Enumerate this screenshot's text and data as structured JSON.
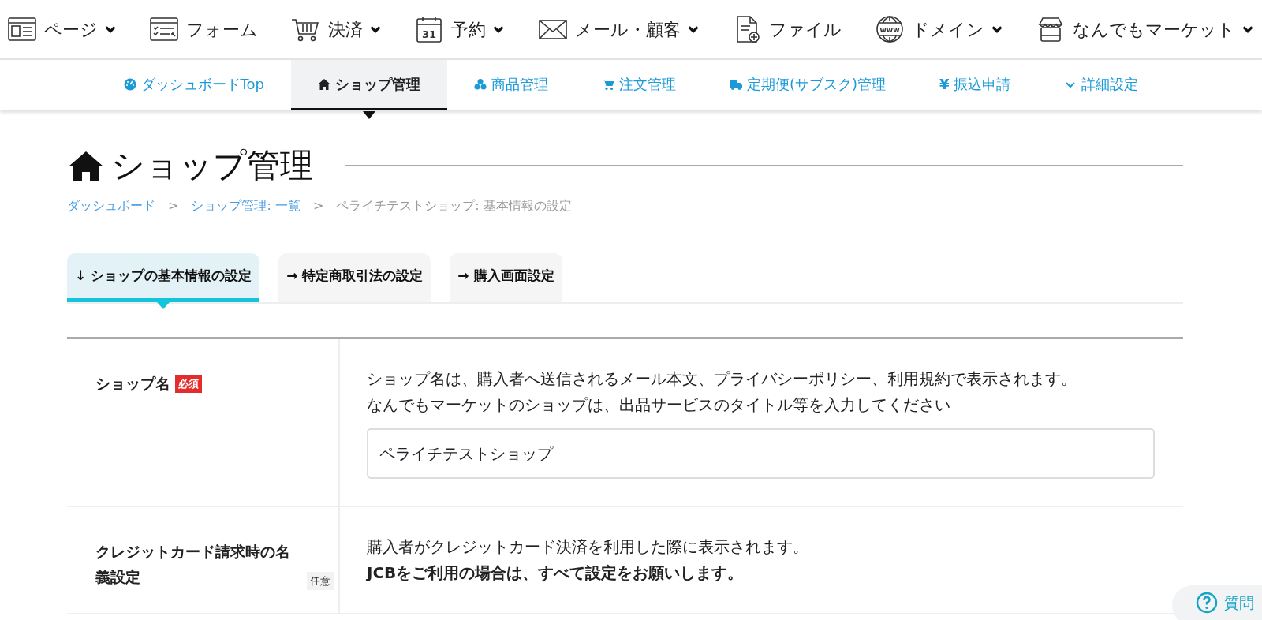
{
  "top_nav": [
    {
      "label": "ページ",
      "has_menu": true
    },
    {
      "label": "フォーム",
      "has_menu": false
    },
    {
      "label": "決済",
      "has_menu": true
    },
    {
      "label": "予約",
      "has_menu": true,
      "icon_text": "31"
    },
    {
      "label": "メール・顧客",
      "has_menu": true
    },
    {
      "label": "ファイル",
      "has_menu": false
    },
    {
      "label": "ドメイン",
      "has_menu": true,
      "icon_text": "www"
    },
    {
      "label": "なんでもマーケット",
      "has_menu": true
    }
  ],
  "sub_nav": [
    {
      "label": "ダッシュボードTop",
      "selected": false
    },
    {
      "label": "ショップ管理",
      "selected": true
    },
    {
      "label": "商品管理",
      "selected": false
    },
    {
      "label": "注文管理",
      "selected": false
    },
    {
      "label": "定期便(サブスク)管理",
      "selected": false
    },
    {
      "label": "振込申請",
      "selected": false,
      "glyph": "¥"
    },
    {
      "label": "詳細設定",
      "selected": false
    }
  ],
  "page_title": "ショップ管理",
  "breadcrumb": [
    {
      "label": "ダッシュボード",
      "link": true
    },
    {
      "label": "ショップ管理: 一覧",
      "link": true
    },
    {
      "label": "ペライチテストショップ: 基本情報の設定",
      "link": false
    }
  ],
  "breadcrumb_separator": ">",
  "tabs": [
    {
      "arrow": "↓",
      "label": "ショップの基本情報の設定",
      "selected": true
    },
    {
      "arrow": "→",
      "label": "特定商取引法の設定",
      "selected": false
    },
    {
      "arrow": "→",
      "label": "購入画面設定",
      "selected": false
    }
  ],
  "form_rows": [
    {
      "label": "ショップ名",
      "badge": "必須",
      "required": true,
      "description": [
        "ショップ名は、購入者へ送信されるメール本文、プライバシーポリシー、利用規約で表示されます。",
        "なんでもマーケットのショップは、出品サービスのタイトル等を入力してください"
      ],
      "value": "ペライチテストショップ"
    },
    {
      "label": "クレジットカード請求時の名義設定",
      "badge": "任意",
      "required": false,
      "description": [
        "購入者がクレジットカード決済を利用した際に表示されます。",
        "**JCBをご利用の場合は、すべて設定をお願いします。**"
      ]
    }
  ],
  "help_button": {
    "label": "質問"
  }
}
